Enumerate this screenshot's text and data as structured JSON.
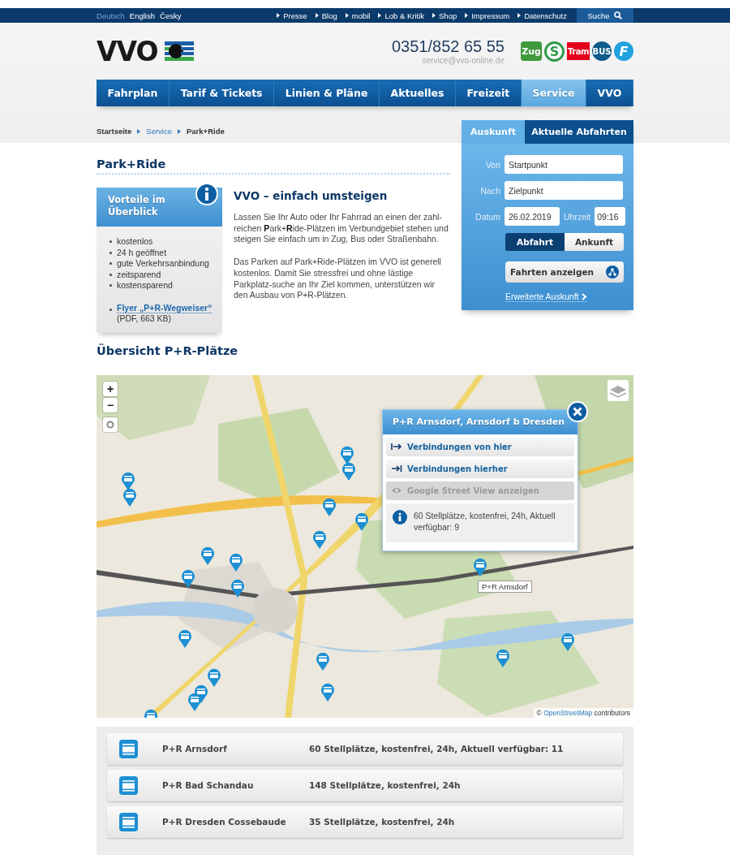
{
  "topbar": {
    "languages": [
      {
        "label": "Deutsch",
        "selected": true
      },
      {
        "label": "English",
        "selected": false
      },
      {
        "label": "Česky",
        "selected": false
      }
    ],
    "links": [
      "Presse",
      "Blog",
      "mobil",
      "Lob & Kritik",
      "Shop",
      "Impressum",
      "Datenschutz"
    ],
    "search": "Suche"
  },
  "header": {
    "logo": "VVO",
    "phone": "0351/852 65 55",
    "email": "service@vvo-online.de",
    "modes": [
      {
        "label": "Zug",
        "kind": "zug"
      },
      {
        "label": "S",
        "kind": "sbahn"
      },
      {
        "label": "Tram",
        "kind": "tram"
      },
      {
        "label": "BUS",
        "kind": "bus"
      },
      {
        "label": "F",
        "kind": "ferry"
      }
    ]
  },
  "nav": [
    {
      "label": "Fahrplan",
      "selected": false
    },
    {
      "label": "Tarif & Tickets",
      "selected": false
    },
    {
      "label": "Linien & Pläne",
      "selected": false
    },
    {
      "label": "Aktuelles",
      "selected": false
    },
    {
      "label": "Freizeit",
      "selected": false
    },
    {
      "label": "Service",
      "selected": true
    },
    {
      "label": "VVO",
      "selected": false
    }
  ],
  "breadcrumb": [
    {
      "label": "Startseite",
      "kind": "root"
    },
    {
      "label": "Service",
      "kind": "link"
    },
    {
      "label": "Park+Ride",
      "kind": "current"
    }
  ],
  "page_title": "Park+Ride",
  "benefits": {
    "title": "Vorteile im Überblick",
    "items": [
      "kostenlos",
      "24 h geöffnet",
      "gute Verkehrsanbindung",
      "zeitsparend",
      "kostensparend"
    ],
    "flyer_link": "Flyer „P+R-Wegweiser“",
    "flyer_meta": "(PDF, 663 KB)"
  },
  "intro": {
    "heading": "VVO – einfach umsteigen",
    "paragraphs": [
      "Lassen Sie Ihr Auto oder Ihr Fahrrad an einen der zahl-reichen **P**ark+**R**ide-Plätzen im Verbundgebiet stehen und steigen Sie einfach um in Zug, Bus oder Straßenbahn.",
      "Das Parken auf Park+Ride-Plätzen im VVO ist generell kostenlos. Damit Sie stressfrei und ohne lästige Parkplatz-suche an Ihr Ziel kommen, unterstützen wir den Ausbau von P+R-Plätzen."
    ]
  },
  "journey": {
    "tabs": [
      {
        "label": "Auskunft",
        "selected": true
      },
      {
        "label": "Aktuelle Abfahrten",
        "selected": false
      }
    ],
    "fields": [
      {
        "label": "Von",
        "placeholder": "Startpunkt"
      },
      {
        "label": "Nach",
        "placeholder": "Zielpunkt"
      }
    ],
    "date": {
      "label": "Datum",
      "value": "26.02.2019"
    },
    "time": {
      "label": "Uhrzeit",
      "value": "09:16"
    },
    "mode_toggle": [
      {
        "label": "Abfahrt",
        "selected": true
      },
      {
        "label": "Ankunft",
        "selected": false
      }
    ],
    "submit": "Fahrten anzeigen",
    "advanced_link": "Erweiterte Auskunft"
  },
  "overview_title": "Übersicht P+R-Plätze",
  "map": {
    "zoom_in": "+",
    "zoom_out": "−",
    "popup": {
      "title": "P+R Arnsdorf, Arnsdorf b Dresden",
      "actions": [
        {
          "label": "Verbindungen von hier",
          "kind": "from",
          "disabled": false
        },
        {
          "label": "Verbindungen hierher",
          "kind": "to",
          "disabled": false
        },
        {
          "label": "Google Street View anzeigen",
          "kind": "streetview",
          "disabled": true
        }
      ],
      "info": "60 Stellplätze, kostenfrei, 24h, Aktuell verfügbar: 9"
    },
    "tooltip": "P+R Arnsdorf",
    "attribution_prefix": "©",
    "attribution_link": "OpenStreetMap",
    "attribution_suffix": "contributors"
  },
  "parkings": [
    {
      "name": "P+R Arnsdorf",
      "details": "60 Stellplätze, kostenfrei, 24h, Aktuell verfügbar: 11"
    },
    {
      "name": "P+R Bad Schandau",
      "details": "148 Stellplätze, kostenfrei, 24h"
    },
    {
      "name": "P+R Dresden Cossebaude",
      "details": "35 Stellplätze, kostenfrei, 24h"
    }
  ]
}
